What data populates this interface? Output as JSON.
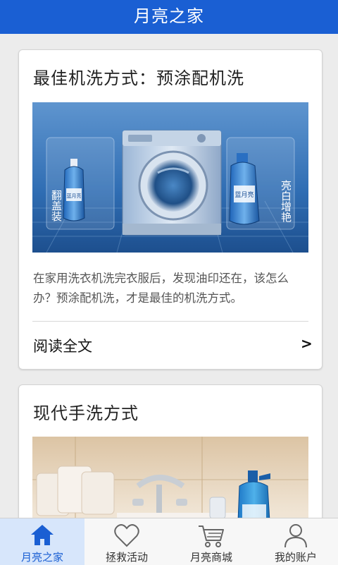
{
  "app": {
    "title": "月亮之家"
  },
  "colors": {
    "accent": "#1a5fd3",
    "active_tab_bg": "#d7e6fb"
  },
  "articles": [
    {
      "title": "最佳机洗方式：预涂配机洗",
      "image": {
        "subject": "washing-machine-with-detergent-bottles",
        "left_caption": "翻盖装",
        "right_caption": "亮白增艳",
        "bottle_brand": "蓝月亮"
      },
      "excerpt": "在家用洗衣机洗完衣服后，发现油印还在，该怎么办？预涂配机洗，才是最佳的机洗方式。",
      "read_more": "阅读全文",
      "read_more_icon": "chevron-right-icon"
    },
    {
      "title": "现代手洗方式",
      "image": {
        "subject": "bathroom-sink-with-detergent-bottle"
      }
    }
  ],
  "tabs": [
    {
      "label": "月亮之家",
      "icon": "home-icon",
      "active": true
    },
    {
      "label": "拯救活动",
      "icon": "heart-icon",
      "active": false
    },
    {
      "label": "月亮商城",
      "icon": "cart-icon",
      "active": false
    },
    {
      "label": "我的账户",
      "icon": "user-icon",
      "active": false
    }
  ]
}
